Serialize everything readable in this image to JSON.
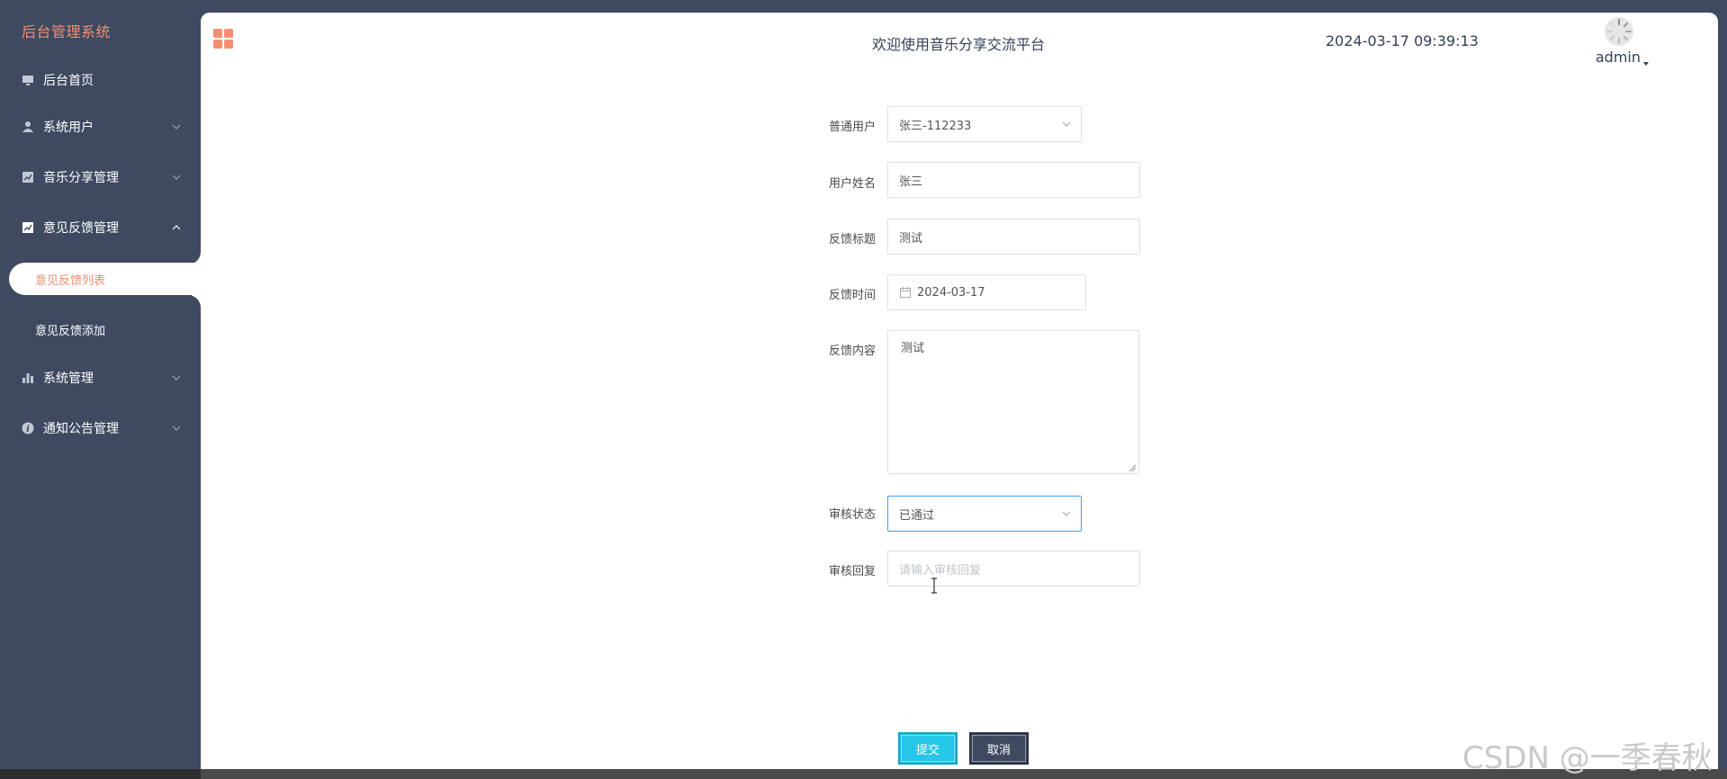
{
  "app": {
    "brand": "后台管理系统",
    "title": "欢迎使用音乐分享交流平台",
    "datetime": "2024-03-17 09:39:13",
    "user": "admin"
  },
  "sidebar": {
    "items": [
      {
        "label": "后台首页",
        "icon": "monitor-icon"
      },
      {
        "label": "系统用户",
        "icon": "user-icon"
      },
      {
        "label": "音乐分享管理",
        "icon": "chart-icon"
      },
      {
        "label": "意见反馈管理",
        "icon": "chart-icon"
      },
      {
        "label": "系统管理",
        "icon": "bar-chart-icon"
      },
      {
        "label": "通知公告管理",
        "icon": "info-icon"
      }
    ],
    "submenu": [
      {
        "label": "意见反馈列表",
        "active": true
      },
      {
        "label": "意见反馈添加",
        "active": false
      }
    ]
  },
  "form": {
    "user_label": "普通用户",
    "user_value": "张三-112233",
    "name_label": "用户姓名",
    "name_value": "张三",
    "title_label": "反馈标题",
    "title_value": "测试",
    "time_label": "反馈时间",
    "time_value": "2024-03-17",
    "content_label": "反馈内容",
    "content_value": "测试",
    "status_label": "审核状态",
    "status_value": "已通过",
    "reply_label": "审核回复",
    "reply_placeholder": "请输入审核回复"
  },
  "buttons": {
    "submit": "提交",
    "cancel": "取消"
  },
  "watermark": "CSDN @一季春秋",
  "colors": {
    "sidebar_bg": "#3f4a60",
    "accent": "#f28e72",
    "submit_bg": "#26c6e6",
    "cancel_bg": "#3f4a60",
    "focus_border": "#409eff"
  }
}
